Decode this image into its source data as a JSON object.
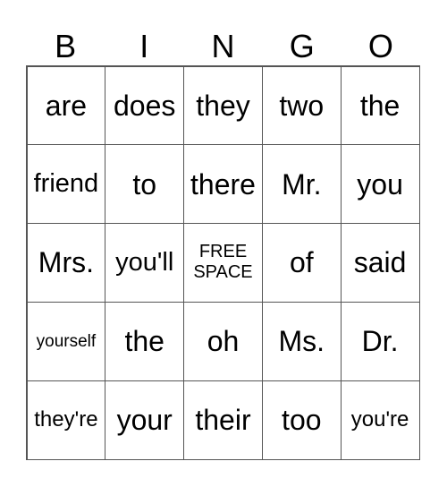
{
  "header": {
    "letters": [
      "B",
      "I",
      "N",
      "G",
      "O"
    ]
  },
  "grid": {
    "rows": [
      [
        "are",
        "does",
        "they",
        "two",
        "the"
      ],
      [
        "friend",
        "to",
        "there",
        "Mr.",
        "you"
      ],
      [
        "Mrs.",
        "you'll",
        "FREE SPACE",
        "of",
        "said"
      ],
      [
        "yourself",
        "the",
        "oh",
        "Ms.",
        "Dr."
      ],
      [
        "they're",
        "your",
        "their",
        "too",
        "you're"
      ]
    ]
  }
}
